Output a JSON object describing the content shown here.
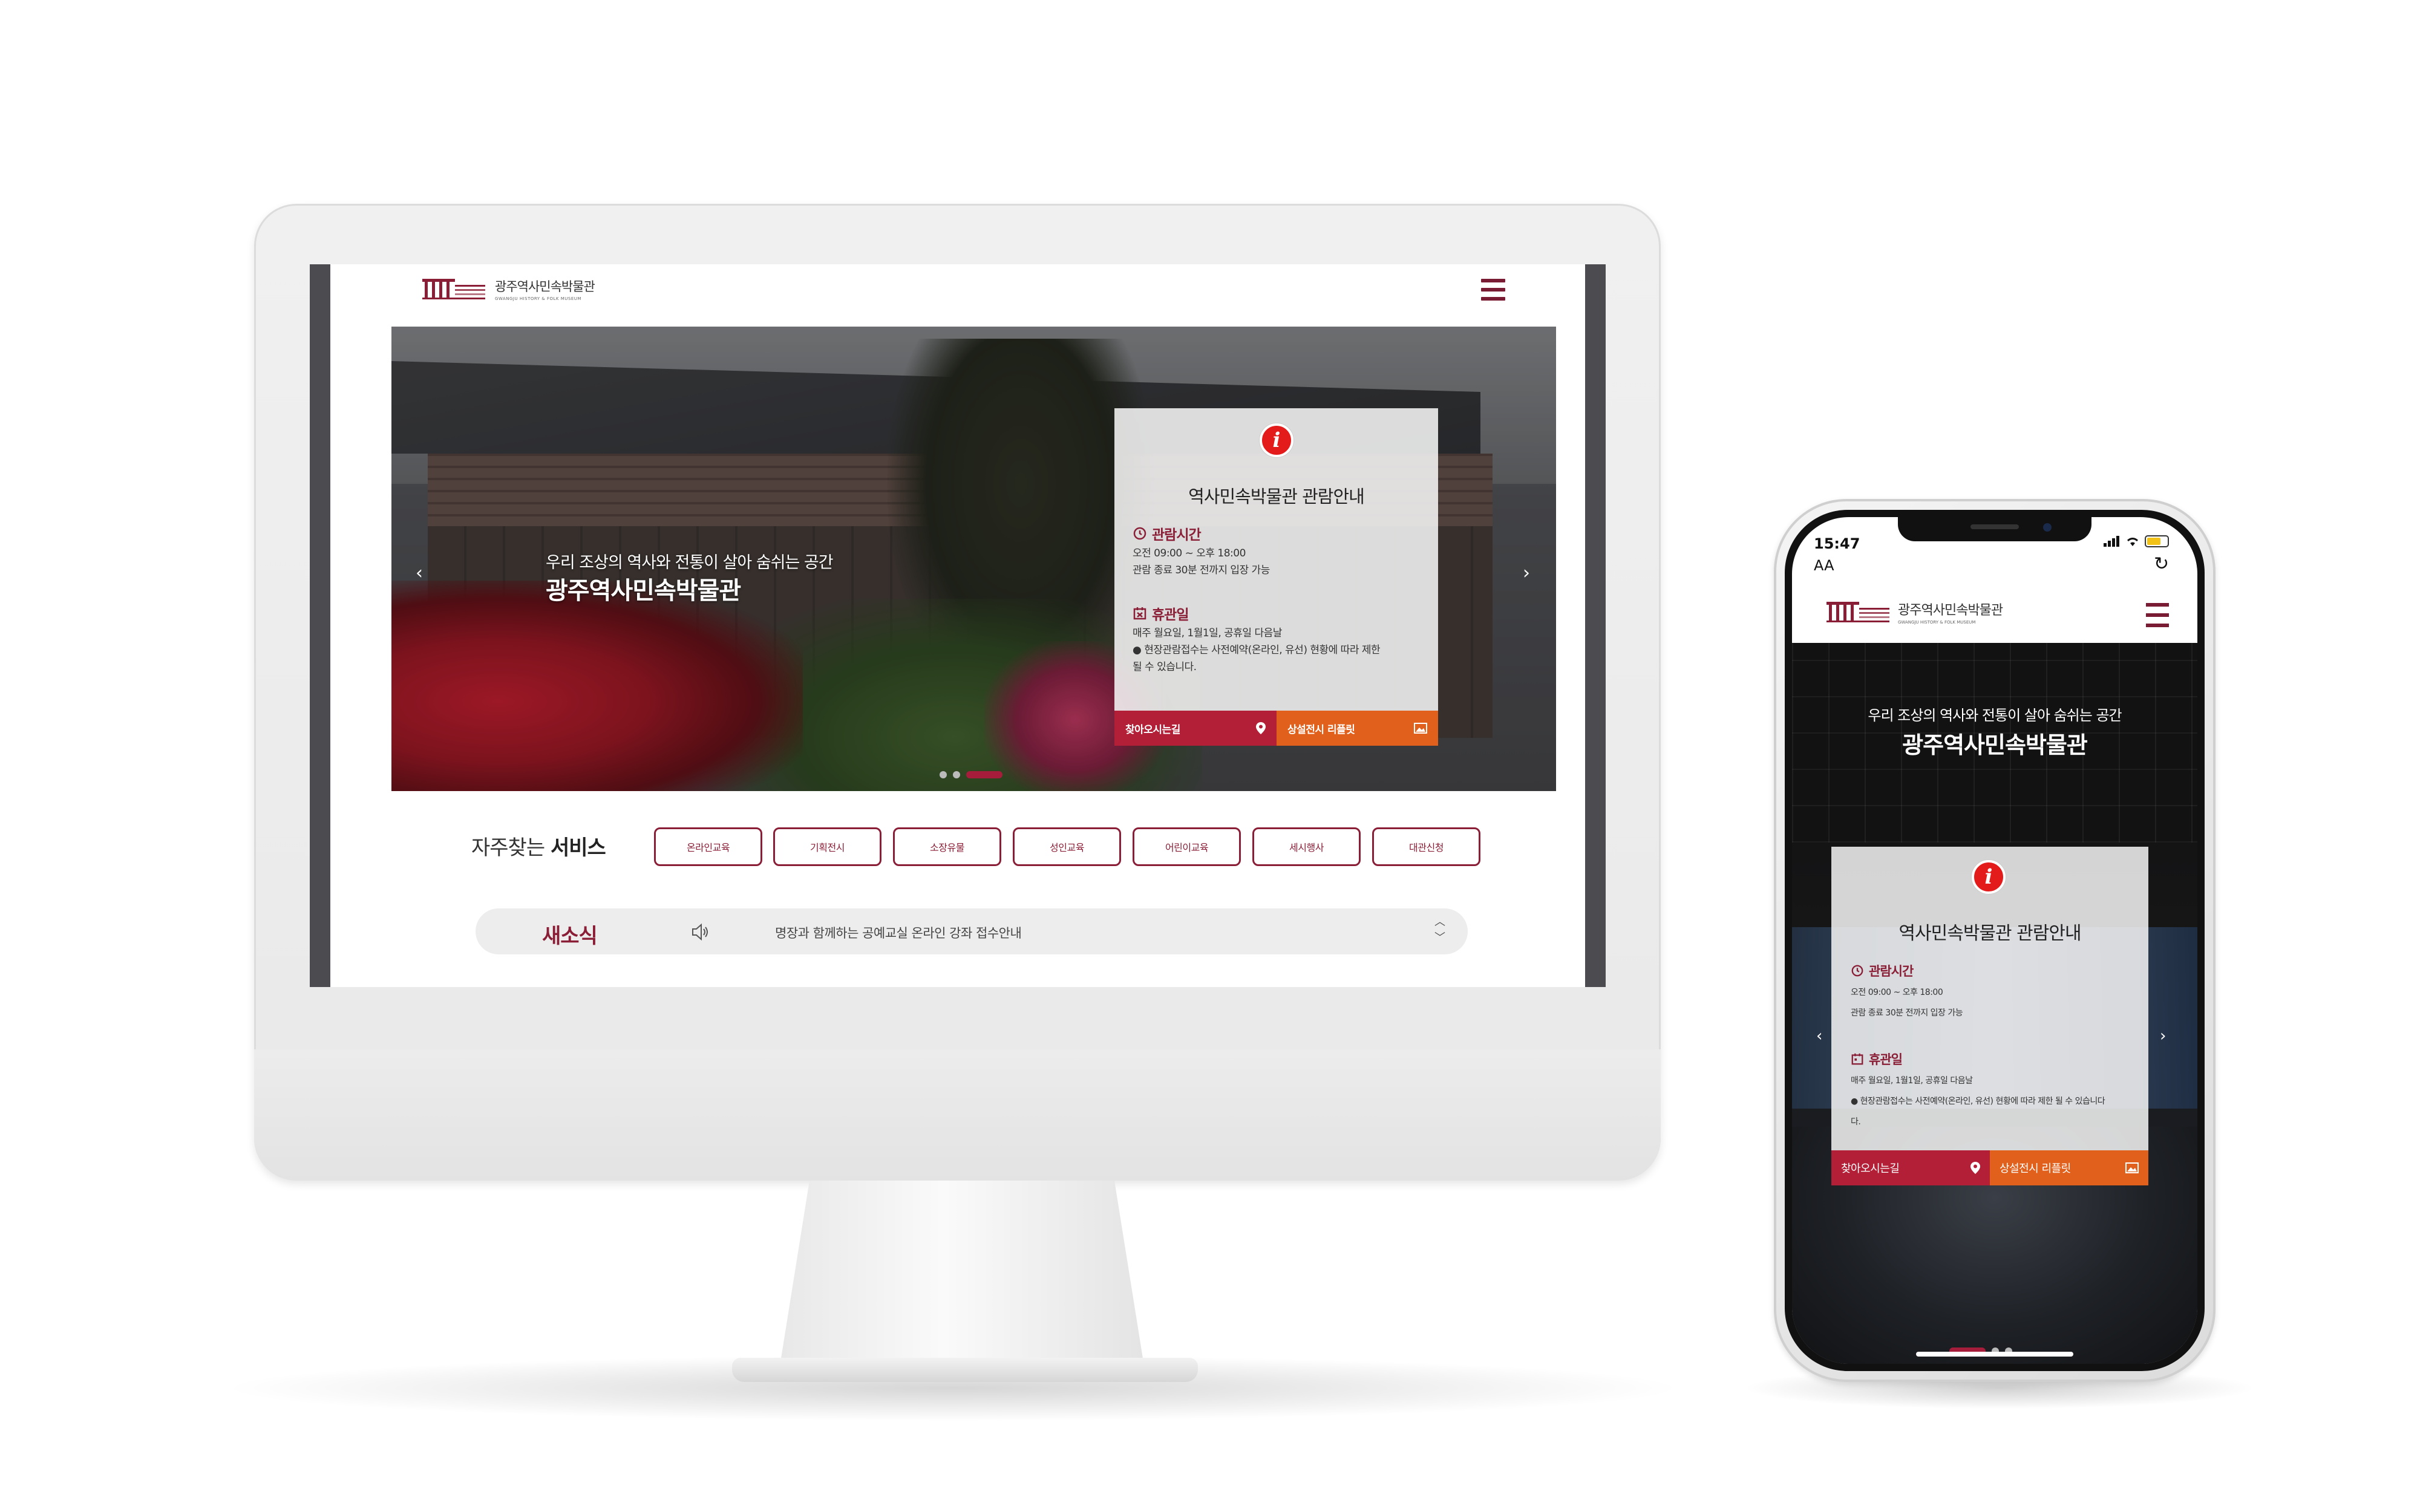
{
  "desktop": {
    "logo": {
      "name_ko": "광주역사민속박물관",
      "name_en": "GWANGJU HISTORY & FOLK MUSEUM"
    },
    "hero": {
      "subtitle": "우리 조상의 역사와 전통이 살아 숨쉬는 공간",
      "title": "광주역사민속박물관",
      "prev_arrow": "‹",
      "next_arrow": "›"
    },
    "info_card": {
      "icon": "i",
      "title": "역사민속박물관 관람안내",
      "hours_heading": "관람시간",
      "hours_line1": "오전 09:00 ~ 오후 18:00",
      "hours_line2": "관람 종료 30분 전까지 입장 가능",
      "closed_heading": "휴관일",
      "closed_line1": "매주 월요일, 1월1일, 공휴일 다음날",
      "closed_line2": "● 현장관람접수는 사전예약(온라인, 유선) 현황에 따라 제한",
      "closed_line3": "될 수 있습니다.",
      "directions_label": "찾아오시는길",
      "leaflet_label": "상설전시 리플릿"
    },
    "services": {
      "label_light": "자주찾는",
      "label_bold": "서비스",
      "items": [
        "온라인교육",
        "기획전시",
        "소장유물",
        "성인교육",
        "어린이교육",
        "세시행사",
        "대관신청"
      ]
    },
    "news": {
      "label": "새소식",
      "text": "명장과 함께하는 공예교실 온라인 강좌 접수안내",
      "up": "︿",
      "down": "﹀"
    }
  },
  "mobile": {
    "status": {
      "time": "15:47",
      "aa": "AA",
      "reload": "↻"
    },
    "logo": {
      "name_ko": "광주역사민속박물관",
      "name_en": "GWANGJU HISTORY & FOLK MUSEUM"
    },
    "hero": {
      "subtitle": "우리 조상의 역사와 전통이 살아 숨쉬는 공간",
      "title": "광주역사민속박물관",
      "prev_arrow": "‹",
      "next_arrow": "›"
    },
    "info_card": {
      "icon": "i",
      "title": "역사민속박물관 관람안내",
      "hours_heading": "관람시간",
      "hours_line1": "오전 09:00 ~ 오후 18:00",
      "hours_line2": "관람 종료 30분 전까지 입장 가능",
      "closed_heading": "휴관일",
      "closed_line1": "매주 월요일, 1월1일, 공휴일 다음날",
      "closed_line2": "● 현장관람접수는 사전예약(온라인, 유선) 현황에 따라 제한 될 수 있습니다",
      "closed_line3": "다.",
      "directions_label": "찾아오시는길",
      "leaflet_label": "상설전시 리플릿"
    }
  },
  "colors": {
    "brand": "#8a1e36",
    "directions_btn": "#b21f36",
    "leaflet_btn": "#e0601c",
    "info_icon": "#e41b1b"
  }
}
